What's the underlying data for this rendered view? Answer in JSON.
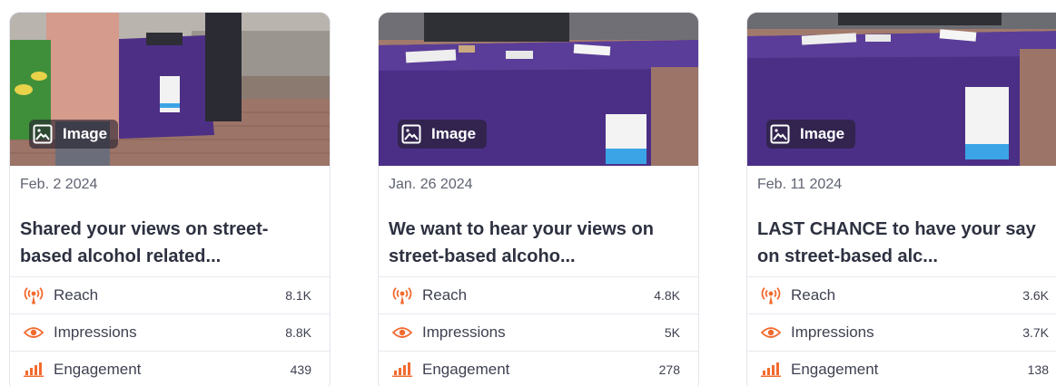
{
  "colors": {
    "metric_icon": "#f26a2e",
    "table_purple": "#4b2f86",
    "badge_bg": "#2a2533"
  },
  "media_label": "Image",
  "metric_labels": {
    "reach": "Reach",
    "impressions": "Impressions",
    "engagement": "Engagement"
  },
  "metric_icons": {
    "reach": "broadcast-icon",
    "impressions": "eye-icon",
    "engagement": "bar-chart-icon"
  },
  "posts": [
    {
      "date": "Feb. 2 2024",
      "title": "Shared your views on street-based alcohol related...",
      "reach": "8.1K",
      "impressions": "8.8K",
      "engagement": "439"
    },
    {
      "date": "Jan. 26 2024",
      "title": "We want to hear your views on street-based alcoho...",
      "reach": "4.8K",
      "impressions": "5K",
      "engagement": "278"
    },
    {
      "date": "Feb. 11 2024",
      "title": "LAST CHANCE to have your say on street-based alc...",
      "reach": "3.6K",
      "impressions": "3.7K",
      "engagement": "138"
    }
  ]
}
